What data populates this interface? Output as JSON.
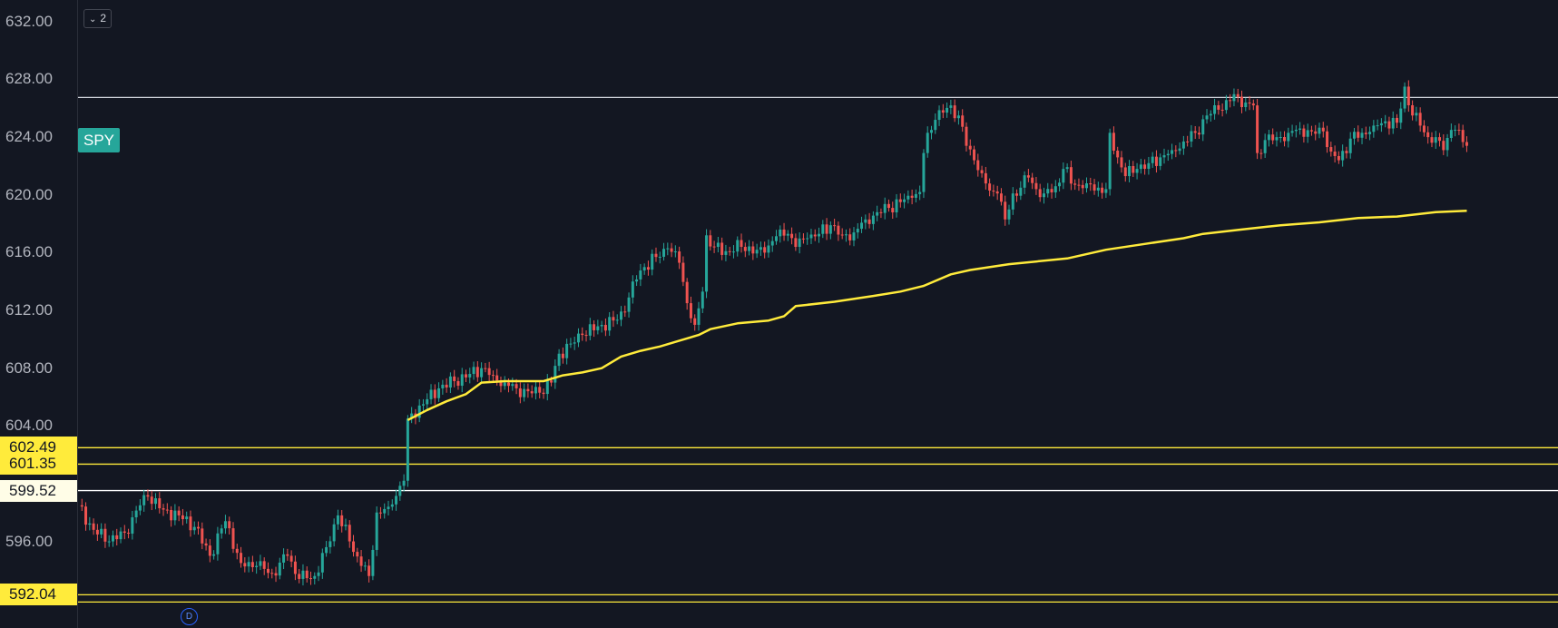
{
  "chart_data": {
    "type": "candlestick",
    "symbol": "SPY",
    "ylim": [
      590.0,
      633.5
    ],
    "y_ticks": [
      632,
      628,
      624,
      620,
      616,
      612,
      608,
      604,
      596
    ],
    "y_tick_labels": [
      "632.00",
      "628.00",
      "624.00",
      "620.00",
      "616.00",
      "612.00",
      "608.00",
      "604.00",
      "596.00"
    ],
    "horizontal_levels": [
      {
        "price": 626.75,
        "color": "#d1d4dc"
      },
      {
        "price": 602.49,
        "color": "#ffeb3b",
        "label": "602.49"
      },
      {
        "price": 601.35,
        "color": "#ffeb3b",
        "label": "601.35"
      },
      {
        "price": 599.52,
        "color": "#ffffff",
        "label": "599.52"
      },
      {
        "price": 592.3,
        "color": "#ffeb3b",
        "label": "592.04"
      },
      {
        "price": 591.8,
        "color": "#ffeb3b"
      }
    ],
    "candle_anchors": [
      {
        "i": 0,
        "c": 598.5
      },
      {
        "i": 4,
        "c": 596.8
      },
      {
        "i": 8,
        "c": 596.0
      },
      {
        "i": 12,
        "c": 596.6
      },
      {
        "i": 16,
        "c": 598.5
      },
      {
        "i": 18,
        "c": 599.1
      },
      {
        "i": 22,
        "c": 598.2
      },
      {
        "i": 26,
        "c": 597.8
      },
      {
        "i": 30,
        "c": 597.0
      },
      {
        "i": 34,
        "c": 595.0
      },
      {
        "i": 38,
        "c": 597.4
      },
      {
        "i": 42,
        "c": 594.5
      },
      {
        "i": 46,
        "c": 594.3
      },
      {
        "i": 50,
        "c": 593.8
      },
      {
        "i": 54,
        "c": 595.0
      },
      {
        "i": 57,
        "c": 593.4
      },
      {
        "i": 61,
        "c": 593.6
      },
      {
        "i": 64,
        "c": 595.6
      },
      {
        "i": 67,
        "c": 597.8
      },
      {
        "i": 70,
        "c": 596.0
      },
      {
        "i": 73,
        "c": 594.3
      },
      {
        "i": 75,
        "c": 593.6
      },
      {
        "i": 77,
        "c": 598.0
      },
      {
        "i": 80,
        "c": 598.4
      },
      {
        "i": 84,
        "c": 600.2
      },
      {
        "i": 85,
        "c": 604.5
      },
      {
        "i": 89,
        "c": 605.5
      },
      {
        "i": 93,
        "c": 606.6
      },
      {
        "i": 97,
        "c": 607.1
      },
      {
        "i": 101,
        "c": 607.6
      },
      {
        "i": 104,
        "c": 608.0
      },
      {
        "i": 107,
        "c": 607.5
      },
      {
        "i": 110,
        "c": 607.0
      },
      {
        "i": 113,
        "c": 606.6
      },
      {
        "i": 116,
        "c": 606.4
      },
      {
        "i": 119,
        "c": 606.3
      },
      {
        "i": 122,
        "c": 607.0
      },
      {
        "i": 124,
        "c": 609.0
      },
      {
        "i": 127,
        "c": 609.7
      },
      {
        "i": 130,
        "c": 610.3
      },
      {
        "i": 134,
        "c": 610.9
      },
      {
        "i": 138,
        "c": 611.3
      },
      {
        "i": 141,
        "c": 611.9
      },
      {
        "i": 143,
        "c": 614.0
      },
      {
        "i": 146,
        "c": 615.0
      },
      {
        "i": 149,
        "c": 615.7
      },
      {
        "i": 152,
        "c": 616.3
      },
      {
        "i": 155,
        "c": 615.3
      },
      {
        "i": 157,
        "c": 612.5
      },
      {
        "i": 159,
        "c": 611.0
      },
      {
        "i": 161,
        "c": 613.3
      },
      {
        "i": 162,
        "c": 617.2
      },
      {
        "i": 164,
        "c": 616.4
      },
      {
        "i": 167,
        "c": 616.1
      },
      {
        "i": 171,
        "c": 616.4
      },
      {
        "i": 175,
        "c": 616.2
      },
      {
        "i": 177,
        "c": 616.0
      },
      {
        "i": 179,
        "c": 616.8
      },
      {
        "i": 181,
        "c": 617.6
      },
      {
        "i": 183,
        "c": 617.3
      },
      {
        "i": 185,
        "c": 616.4
      },
      {
        "i": 188,
        "c": 617.0
      },
      {
        "i": 191,
        "c": 617.3
      },
      {
        "i": 194,
        "c": 617.9
      },
      {
        "i": 197,
        "c": 617.2
      },
      {
        "i": 200,
        "c": 617.4
      },
      {
        "i": 203,
        "c": 618.3
      },
      {
        "i": 206,
        "c": 618.8
      },
      {
        "i": 209,
        "c": 619.1
      },
      {
        "i": 212,
        "c": 619.5
      },
      {
        "i": 215,
        "c": 619.8
      },
      {
        "i": 217,
        "c": 620.2
      },
      {
        "i": 218,
        "c": 622.9
      },
      {
        "i": 219,
        "c": 624.3
      },
      {
        "i": 221,
        "c": 625.2
      },
      {
        "i": 223,
        "c": 625.7
      },
      {
        "i": 225,
        "c": 626.2
      },
      {
        "i": 227,
        "c": 625.5
      },
      {
        "i": 229,
        "c": 623.4
      },
      {
        "i": 231,
        "c": 622.4
      },
      {
        "i": 233,
        "c": 621.5
      },
      {
        "i": 235,
        "c": 620.3
      },
      {
        "i": 237,
        "c": 620.1
      },
      {
        "i": 239,
        "c": 618.3
      },
      {
        "i": 241,
        "c": 620.1
      },
      {
        "i": 243,
        "c": 620.5
      },
      {
        "i": 245,
        "c": 621.2
      },
      {
        "i": 247,
        "c": 620.4
      },
      {
        "i": 249,
        "c": 620.1
      },
      {
        "i": 252,
        "c": 620.6
      },
      {
        "i": 254,
        "c": 621.8
      },
      {
        "i": 257,
        "c": 620.7
      },
      {
        "i": 260,
        "c": 620.8
      },
      {
        "i": 263,
        "c": 620.5
      },
      {
        "i": 265,
        "c": 620.4
      },
      {
        "i": 266,
        "c": 624.3
      },
      {
        "i": 268,
        "c": 622.6
      },
      {
        "i": 270,
        "c": 621.3
      },
      {
        "i": 273,
        "c": 621.8
      },
      {
        "i": 276,
        "c": 622.2
      },
      {
        "i": 279,
        "c": 622.6
      },
      {
        "i": 282,
        "c": 623.1
      },
      {
        "i": 285,
        "c": 623.7
      },
      {
        "i": 288,
        "c": 624.3
      },
      {
        "i": 291,
        "c": 625.5
      },
      {
        "i": 294,
        "c": 625.9
      },
      {
        "i": 297,
        "c": 626.5
      },
      {
        "i": 299,
        "c": 626.8
      },
      {
        "i": 301,
        "c": 626.4
      },
      {
        "i": 303,
        "c": 626.2
      },
      {
        "i": 304,
        "c": 622.9
      },
      {
        "i": 306,
        "c": 623.8
      },
      {
        "i": 309,
        "c": 624.0
      },
      {
        "i": 312,
        "c": 624.3
      },
      {
        "i": 315,
        "c": 624.6
      },
      {
        "i": 318,
        "c": 624.4
      },
      {
        "i": 321,
        "c": 624.4
      },
      {
        "i": 323,
        "c": 623.0
      },
      {
        "i": 325,
        "c": 622.4
      },
      {
        "i": 328,
        "c": 623.9
      },
      {
        "i": 331,
        "c": 624.3
      },
      {
        "i": 334,
        "c": 624.8
      },
      {
        "i": 337,
        "c": 625.1
      },
      {
        "i": 340,
        "c": 625.0
      },
      {
        "i": 342,
        "c": 627.5
      },
      {
        "i": 344,
        "c": 625.5
      },
      {
        "i": 346,
        "c": 624.8
      },
      {
        "i": 348,
        "c": 624.0
      },
      {
        "i": 350,
        "c": 624.0
      },
      {
        "i": 352,
        "c": 623.1
      },
      {
        "i": 354,
        "c": 624.5
      },
      {
        "i": 356,
        "c": 624.5
      },
      {
        "i": 358,
        "c": 623.4
      }
    ],
    "moving_average": [
      {
        "i": 85,
        "v": 604.4
      },
      {
        "i": 90,
        "v": 605.1
      },
      {
        "i": 95,
        "v": 605.7
      },
      {
        "i": 100,
        "v": 606.2
      },
      {
        "i": 104,
        "v": 607.0
      },
      {
        "i": 110,
        "v": 607.1
      },
      {
        "i": 120,
        "v": 607.1
      },
      {
        "i": 125,
        "v": 607.5
      },
      {
        "i": 130,
        "v": 607.7
      },
      {
        "i": 135,
        "v": 608.0
      },
      {
        "i": 140,
        "v": 608.8
      },
      {
        "i": 145,
        "v": 609.2
      },
      {
        "i": 150,
        "v": 609.5
      },
      {
        "i": 155,
        "v": 609.9
      },
      {
        "i": 160,
        "v": 610.3
      },
      {
        "i": 163,
        "v": 610.7
      },
      {
        "i": 170,
        "v": 611.1
      },
      {
        "i": 178,
        "v": 611.3
      },
      {
        "i": 182,
        "v": 611.6
      },
      {
        "i": 185,
        "v": 612.3
      },
      {
        "i": 195,
        "v": 612.6
      },
      {
        "i": 205,
        "v": 613.0
      },
      {
        "i": 212,
        "v": 613.3
      },
      {
        "i": 218,
        "v": 613.7
      },
      {
        "i": 225,
        "v": 614.5
      },
      {
        "i": 230,
        "v": 614.8
      },
      {
        "i": 240,
        "v": 615.2
      },
      {
        "i": 255,
        "v": 615.6
      },
      {
        "i": 265,
        "v": 616.2
      },
      {
        "i": 275,
        "v": 616.6
      },
      {
        "i": 285,
        "v": 617.0
      },
      {
        "i": 290,
        "v": 617.3
      },
      {
        "i": 300,
        "v": 617.6
      },
      {
        "i": 310,
        "v": 617.9
      },
      {
        "i": 320,
        "v": 618.1
      },
      {
        "i": 330,
        "v": 618.4
      },
      {
        "i": 340,
        "v": 618.5
      },
      {
        "i": 350,
        "v": 618.8
      },
      {
        "i": 358,
        "v": 618.9
      }
    ],
    "grid": false,
    "legend": "none"
  },
  "symbol_label": "SPY",
  "collapse_badge": "2",
  "dividend_marker": "D",
  "colors": {
    "background": "#131722",
    "up": "#26a69a",
    "down": "#ef5350",
    "moving_average": "#ffeb3b",
    "level_white": "#ffffff",
    "level_yellow": "#ffeb3b",
    "axis_text": "#b2b5be"
  }
}
